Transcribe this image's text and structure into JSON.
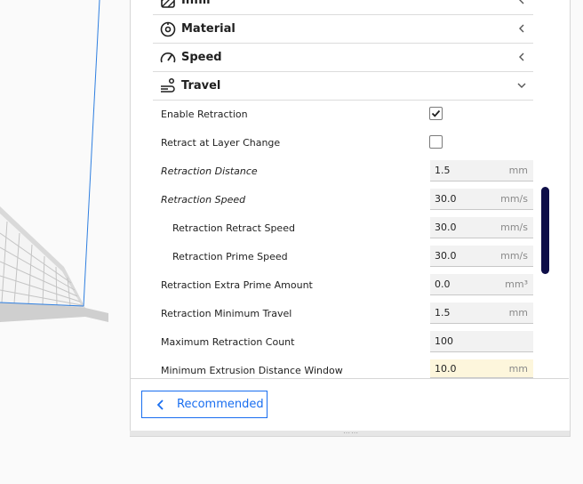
{
  "categories": [
    {
      "label": "Infill",
      "icon": "infill-icon",
      "expanded": false
    },
    {
      "label": "Material",
      "icon": "material-icon",
      "expanded": false
    },
    {
      "label": "Speed",
      "icon": "speed-icon",
      "expanded": false
    },
    {
      "label": "Travel",
      "icon": "travel-icon",
      "expanded": true
    }
  ],
  "settings": [
    {
      "label": "Enable Retraction",
      "type": "checkbox",
      "checked": true
    },
    {
      "label": "Retract at Layer Change",
      "type": "checkbox",
      "checked": false
    },
    {
      "label": "Retraction Distance",
      "type": "number",
      "value": "1.5",
      "unit": "mm"
    },
    {
      "label": "Retraction Speed",
      "type": "number",
      "value": "30.0",
      "unit": "mm/s"
    },
    {
      "label": "Retraction Retract Speed",
      "type": "number",
      "value": "30.0",
      "unit": "mm/s"
    },
    {
      "label": "Retraction Prime Speed",
      "type": "number",
      "value": "30.0",
      "unit": "mm/s"
    },
    {
      "label": "Retraction Extra Prime Amount",
      "type": "number",
      "value": "0.0",
      "unit": "mm³"
    },
    {
      "label": "Retraction Minimum Travel",
      "type": "number",
      "value": "1.5",
      "unit": "mm"
    },
    {
      "label": "Maximum Retraction Count",
      "type": "number",
      "value": "100",
      "unit": ""
    },
    {
      "label": "Minimum Extrusion Distance Window",
      "type": "number",
      "value": "10.0",
      "unit": "mm"
    }
  ],
  "footer": {
    "recommended_label": "Recommended"
  },
  "colors": {
    "accent": "#196ef0",
    "scrollbar": "#0e0e48",
    "warning_field": "#fdf6dc",
    "build_volume_line": "#2f7fe0"
  }
}
